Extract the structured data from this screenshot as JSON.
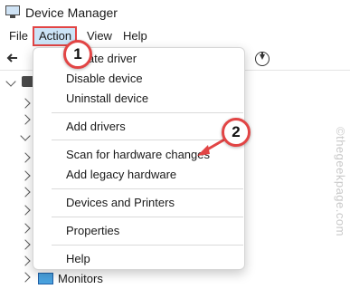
{
  "window": {
    "title": "Device Manager"
  },
  "menubar": {
    "items": [
      {
        "label": "File"
      },
      {
        "label": "Action"
      },
      {
        "label": "View"
      },
      {
        "label": "Help"
      }
    ]
  },
  "action_menu": {
    "items": [
      {
        "label": "Update driver"
      },
      {
        "label": "Disable device"
      },
      {
        "label": "Uninstall device"
      },
      {
        "label": "Add drivers"
      },
      {
        "label": "Scan for hardware changes"
      },
      {
        "label": "Add legacy hardware"
      },
      {
        "label": "Devices and Printers"
      },
      {
        "label": "Properties"
      },
      {
        "label": "Help"
      }
    ]
  },
  "tree": {
    "visible_item": "Monitors"
  },
  "steps": {
    "step1": "1",
    "step2": "2"
  },
  "watermark": {
    "text": "©thegeekpage.com"
  },
  "icons": {
    "app": "device-manager-icon",
    "back": "back-arrow-icon",
    "toolbar_action": "download-circle-icon",
    "monitors": "monitor-icon"
  },
  "colors": {
    "highlight": "#cce4f7",
    "annotation_red": "#e24545"
  }
}
